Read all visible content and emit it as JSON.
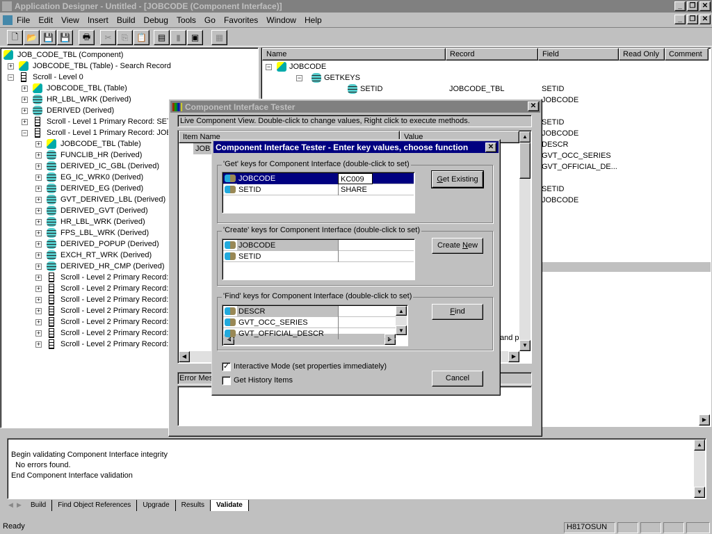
{
  "app": {
    "title": "Application Designer - Untitled - [JOBCODE (Component Interface)]"
  },
  "menu": [
    "File",
    "Edit",
    "View",
    "Insert",
    "Build",
    "Debug",
    "Tools",
    "Go",
    "Favorites",
    "Window",
    "Help"
  ],
  "tree": [
    {
      "label": "JOB_CODE_TBL (Component)",
      "level": 0,
      "icon": "comp",
      "exp": ""
    },
    {
      "label": "JOBCODE_TBL (Table) - Search Record",
      "level": 1,
      "icon": "comp",
      "exp": "+"
    },
    {
      "label": "Scroll - Level 0",
      "level": 1,
      "icon": "scroll",
      "exp": "-"
    },
    {
      "label": "JOBCODE_TBL (Table)",
      "level": 2,
      "icon": "comp",
      "exp": "+"
    },
    {
      "label": "HR_LBL_WRK (Derived)",
      "level": 2,
      "icon": "db",
      "exp": "+"
    },
    {
      "label": "DERIVED (Derived)",
      "level": 2,
      "icon": "db",
      "exp": "+"
    },
    {
      "label": "Scroll - Level 1  Primary Record: SET_",
      "level": 2,
      "icon": "scroll",
      "exp": "+"
    },
    {
      "label": "Scroll - Level 1  Primary Record: JOBC",
      "level": 2,
      "icon": "scroll",
      "exp": "-"
    },
    {
      "label": "JOBCODE_TBL (Table)",
      "level": 3,
      "icon": "comp",
      "exp": "+"
    },
    {
      "label": "FUNCLIB_HR (Derived)",
      "level": 3,
      "icon": "db",
      "exp": "+"
    },
    {
      "label": "DERIVED_IC_GBL (Derived)",
      "level": 3,
      "icon": "db",
      "exp": "+"
    },
    {
      "label": "EG_IC_WRK0 (Derived)",
      "level": 3,
      "icon": "db",
      "exp": "+"
    },
    {
      "label": "DERIVED_EG (Derived)",
      "level": 3,
      "icon": "db",
      "exp": "+"
    },
    {
      "label": "GVT_DERIVED_LBL (Derived)",
      "level": 3,
      "icon": "db",
      "exp": "+"
    },
    {
      "label": "DERIVED_GVT (Derived)",
      "level": 3,
      "icon": "db",
      "exp": "+"
    },
    {
      "label": "HR_LBL_WRK (Derived)",
      "level": 3,
      "icon": "db",
      "exp": "+"
    },
    {
      "label": "FPS_LBL_WRK (Derived)",
      "level": 3,
      "icon": "db",
      "exp": "+"
    },
    {
      "label": "DERIVED_POPUP (Derived)",
      "level": 3,
      "icon": "db",
      "exp": "+"
    },
    {
      "label": "EXCH_RT_WRK (Derived)",
      "level": 3,
      "icon": "db",
      "exp": "+"
    },
    {
      "label": "DERIVED_HR_CMP (Derived)",
      "level": 3,
      "icon": "db",
      "exp": "+"
    },
    {
      "label": "Scroll - Level 2  Primary Record: (",
      "level": 3,
      "icon": "scroll",
      "exp": "+"
    },
    {
      "label": "Scroll - Level 2  Primary Record: (",
      "level": 3,
      "icon": "scroll",
      "exp": "+"
    },
    {
      "label": "Scroll - Level 2  Primary Record: J",
      "level": 3,
      "icon": "scroll",
      "exp": "+"
    },
    {
      "label": "Scroll - Level 2  Primary Record: J",
      "level": 3,
      "icon": "scroll",
      "exp": "+"
    },
    {
      "label": "Scroll - Level 2  Primary Record: J",
      "level": 3,
      "icon": "scroll",
      "exp": "+"
    },
    {
      "label": "Scroll - Level 2  Primary Record: S",
      "level": 3,
      "icon": "scroll",
      "exp": "+"
    },
    {
      "label": "Scroll - Level 2  Primary Record: J",
      "level": 3,
      "icon": "scroll",
      "exp": "+"
    }
  ],
  "ci": {
    "columns": [
      "Name",
      "Record",
      "Field",
      "Read Only",
      "Comment"
    ],
    "rows": [
      {
        "name": "JOBCODE",
        "record": "",
        "field": ""
      },
      {
        "name": "GETKEYS",
        "record": "",
        "field": ""
      },
      {
        "name": "SETID",
        "record": "JOBCODE_TBL",
        "field": "SETID"
      },
      {
        "name": "",
        "record": "",
        "field": "JOBCODE"
      },
      {
        "name": "",
        "record": "",
        "field": ""
      },
      {
        "name": "",
        "record": "",
        "field": "SETID"
      },
      {
        "name": "",
        "record": "",
        "field": "JOBCODE"
      },
      {
        "name": "",
        "record": "",
        "field": "DESCR"
      },
      {
        "name": "",
        "record": "",
        "field": "GVT_OCC_SERIES"
      },
      {
        "name": "",
        "record": "",
        "field": "GVT_OFFICIAL_DE..."
      },
      {
        "name": "",
        "record": "",
        "field": ""
      },
      {
        "name": "",
        "record": "",
        "field": "SETID"
      },
      {
        "name": "",
        "record": "",
        "field": "JOBCODE"
      }
    ]
  },
  "tester": {
    "title": "Component Interface Tester",
    "info": "Live Component View.   Double-click to change values, Right click to execute methods.",
    "col_item": "Item Name",
    "col_value": "Value",
    "root": "JOB",
    "trail": "and p",
    "error_label": "Error Mess"
  },
  "dialog": {
    "title": "Component Interface Tester - Enter key values, choose function",
    "get": {
      "legend": "'Get' keys for Component Interface (double-click to set)",
      "rows": [
        {
          "key": "JOBCODE",
          "value": "KC009"
        },
        {
          "key": "SETID",
          "value": "SHARE"
        }
      ],
      "button": "Get Existing"
    },
    "create": {
      "legend": "'Create' keys for Component Interface (double-click to set)",
      "rows": [
        {
          "key": "JOBCODE",
          "value": ""
        },
        {
          "key": "SETID",
          "value": ""
        }
      ],
      "button": "Create New"
    },
    "find": {
      "legend": "'Find' keys for Component Interface (double-click to set)",
      "rows": [
        {
          "key": "DESCR",
          "value": ""
        },
        {
          "key": "GVT_OCC_SERIES",
          "value": ""
        },
        {
          "key": "GVT_OFFICIAL_DESCR",
          "value": ""
        }
      ],
      "button": "Find"
    },
    "interactive": {
      "label": "Interactive Mode (set properties immediately)",
      "checked": true
    },
    "history": {
      "label": "Get History Items",
      "checked": false
    },
    "cancel": "Cancel"
  },
  "output": {
    "lines": [
      "Begin validating Component Interface integrity",
      "  No errors found.",
      "End Component Interface validation"
    ],
    "tabs": [
      "Build",
      "Find Object References",
      "Upgrade",
      "Results",
      "Validate"
    ],
    "active_tab": "Validate"
  },
  "status": {
    "text": "Ready",
    "server": "H817OSUN"
  }
}
